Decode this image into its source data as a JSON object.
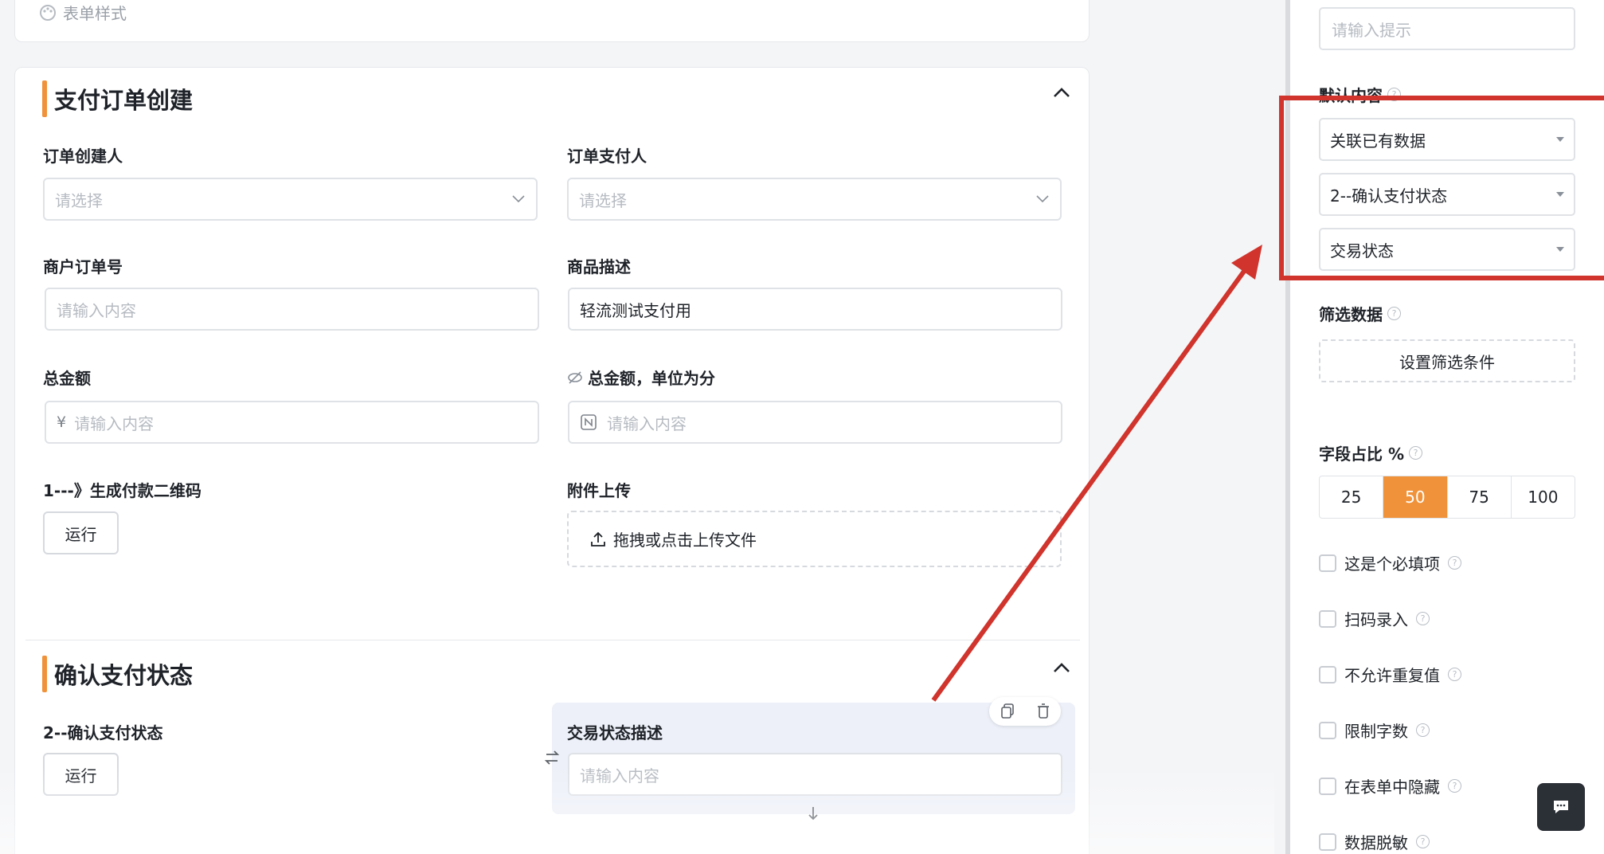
{
  "top_card": {
    "form_style_label": "表单样式"
  },
  "section1": {
    "title": "支付订单创建",
    "fields": {
      "creator_label": "订单创建人",
      "creator_placeholder": "请选择",
      "payer_label": "订单支付人",
      "payer_placeholder": "请选择",
      "merchant_no_label": "商户订单号",
      "merchant_no_placeholder": "请输入内容",
      "desc_label": "商品描述",
      "desc_value": "轻流测试支付用",
      "amount_label": "总金额",
      "amount_prefix": "¥",
      "amount_placeholder": "请输入内容",
      "amount_cents_label": "总金额，单位为分",
      "amount_cents_placeholder": "请输入内容",
      "qrcode_label": "1---》生成付款二维码",
      "run_label": "运行",
      "attach_label": "附件上传",
      "upload_text": "拖拽或点击上传文件"
    }
  },
  "section2": {
    "title": "确认支付状态",
    "fields": {
      "confirm_label": "2--确认支付状态",
      "run_label": "运行",
      "trade_desc_label": "交易状态描述",
      "trade_desc_placeholder": "请输入内容"
    }
  },
  "panel": {
    "hint_placeholder": "请输入提示",
    "default_content_label": "默认内容",
    "default_source": "关联已有数据",
    "default_form": "2--确认支付状态",
    "default_field": "交易状态",
    "filter_label": "筛选数据",
    "filter_button": "设置筛选条件",
    "ratio_label": "字段占比 %",
    "ratio_options": [
      "25",
      "50",
      "75",
      "100"
    ],
    "ratio_selected": "50",
    "checkboxes": [
      "这是个必填项",
      "扫码录入",
      "不允许重复值",
      "限制字数",
      "在表单中隐藏",
      "数据脱敏"
    ]
  },
  "colors": {
    "accent": "#f0923a",
    "annotation": "#d0342c"
  }
}
